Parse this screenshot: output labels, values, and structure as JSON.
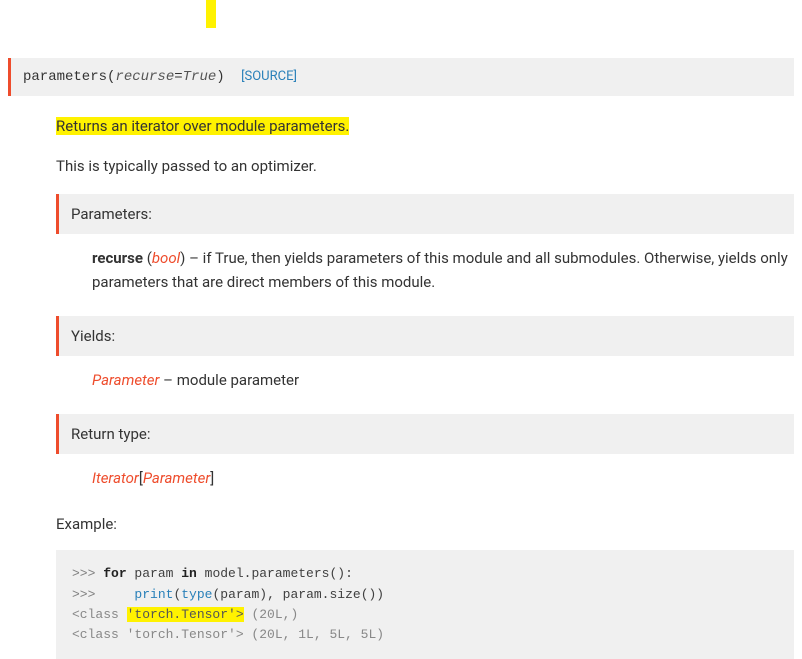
{
  "signature": {
    "name": "parameters",
    "open_paren": "(",
    "param_name": "recurse",
    "equals": "=",
    "default": "True",
    "close_paren": ")",
    "source_label": "[SOURCE]"
  },
  "description": {
    "summary": "Returns an iterator over module parameters.",
    "note": "This is typically passed to an optimizer."
  },
  "parameters": {
    "header": "Parameters:",
    "name": "recurse",
    "open_paren": " (",
    "type": "bool",
    "close_paren": ")",
    "text": " – if True, then yields parameters of this module and all submodules. Otherwise, yields only parameters that are direct members of this module."
  },
  "yields": {
    "header": "Yields:",
    "type": "Parameter",
    "text": " – module parameter"
  },
  "return_type": {
    "header": "Return type:",
    "outer": "Iterator",
    "open_bracket": "[",
    "inner": "Parameter",
    "close_bracket": "]"
  },
  "example": {
    "label": "Example:",
    "line1": {
      "prompt": ">>> ",
      "kw_for": "for",
      "mid1": " param ",
      "kw_in": "in",
      "mid2": " model.parameters():"
    },
    "line2": {
      "prompt": ">>>     ",
      "print": "print",
      "open": "(",
      "type": "type",
      "rest": "(param), param.size())"
    },
    "line3": {
      "pre": "<class ",
      "hl": "'torch.Tensor'>",
      "post": " (20L,)"
    },
    "line4": "<class 'torch.Tensor'> (20L, 1L, 5L, 5L)"
  }
}
